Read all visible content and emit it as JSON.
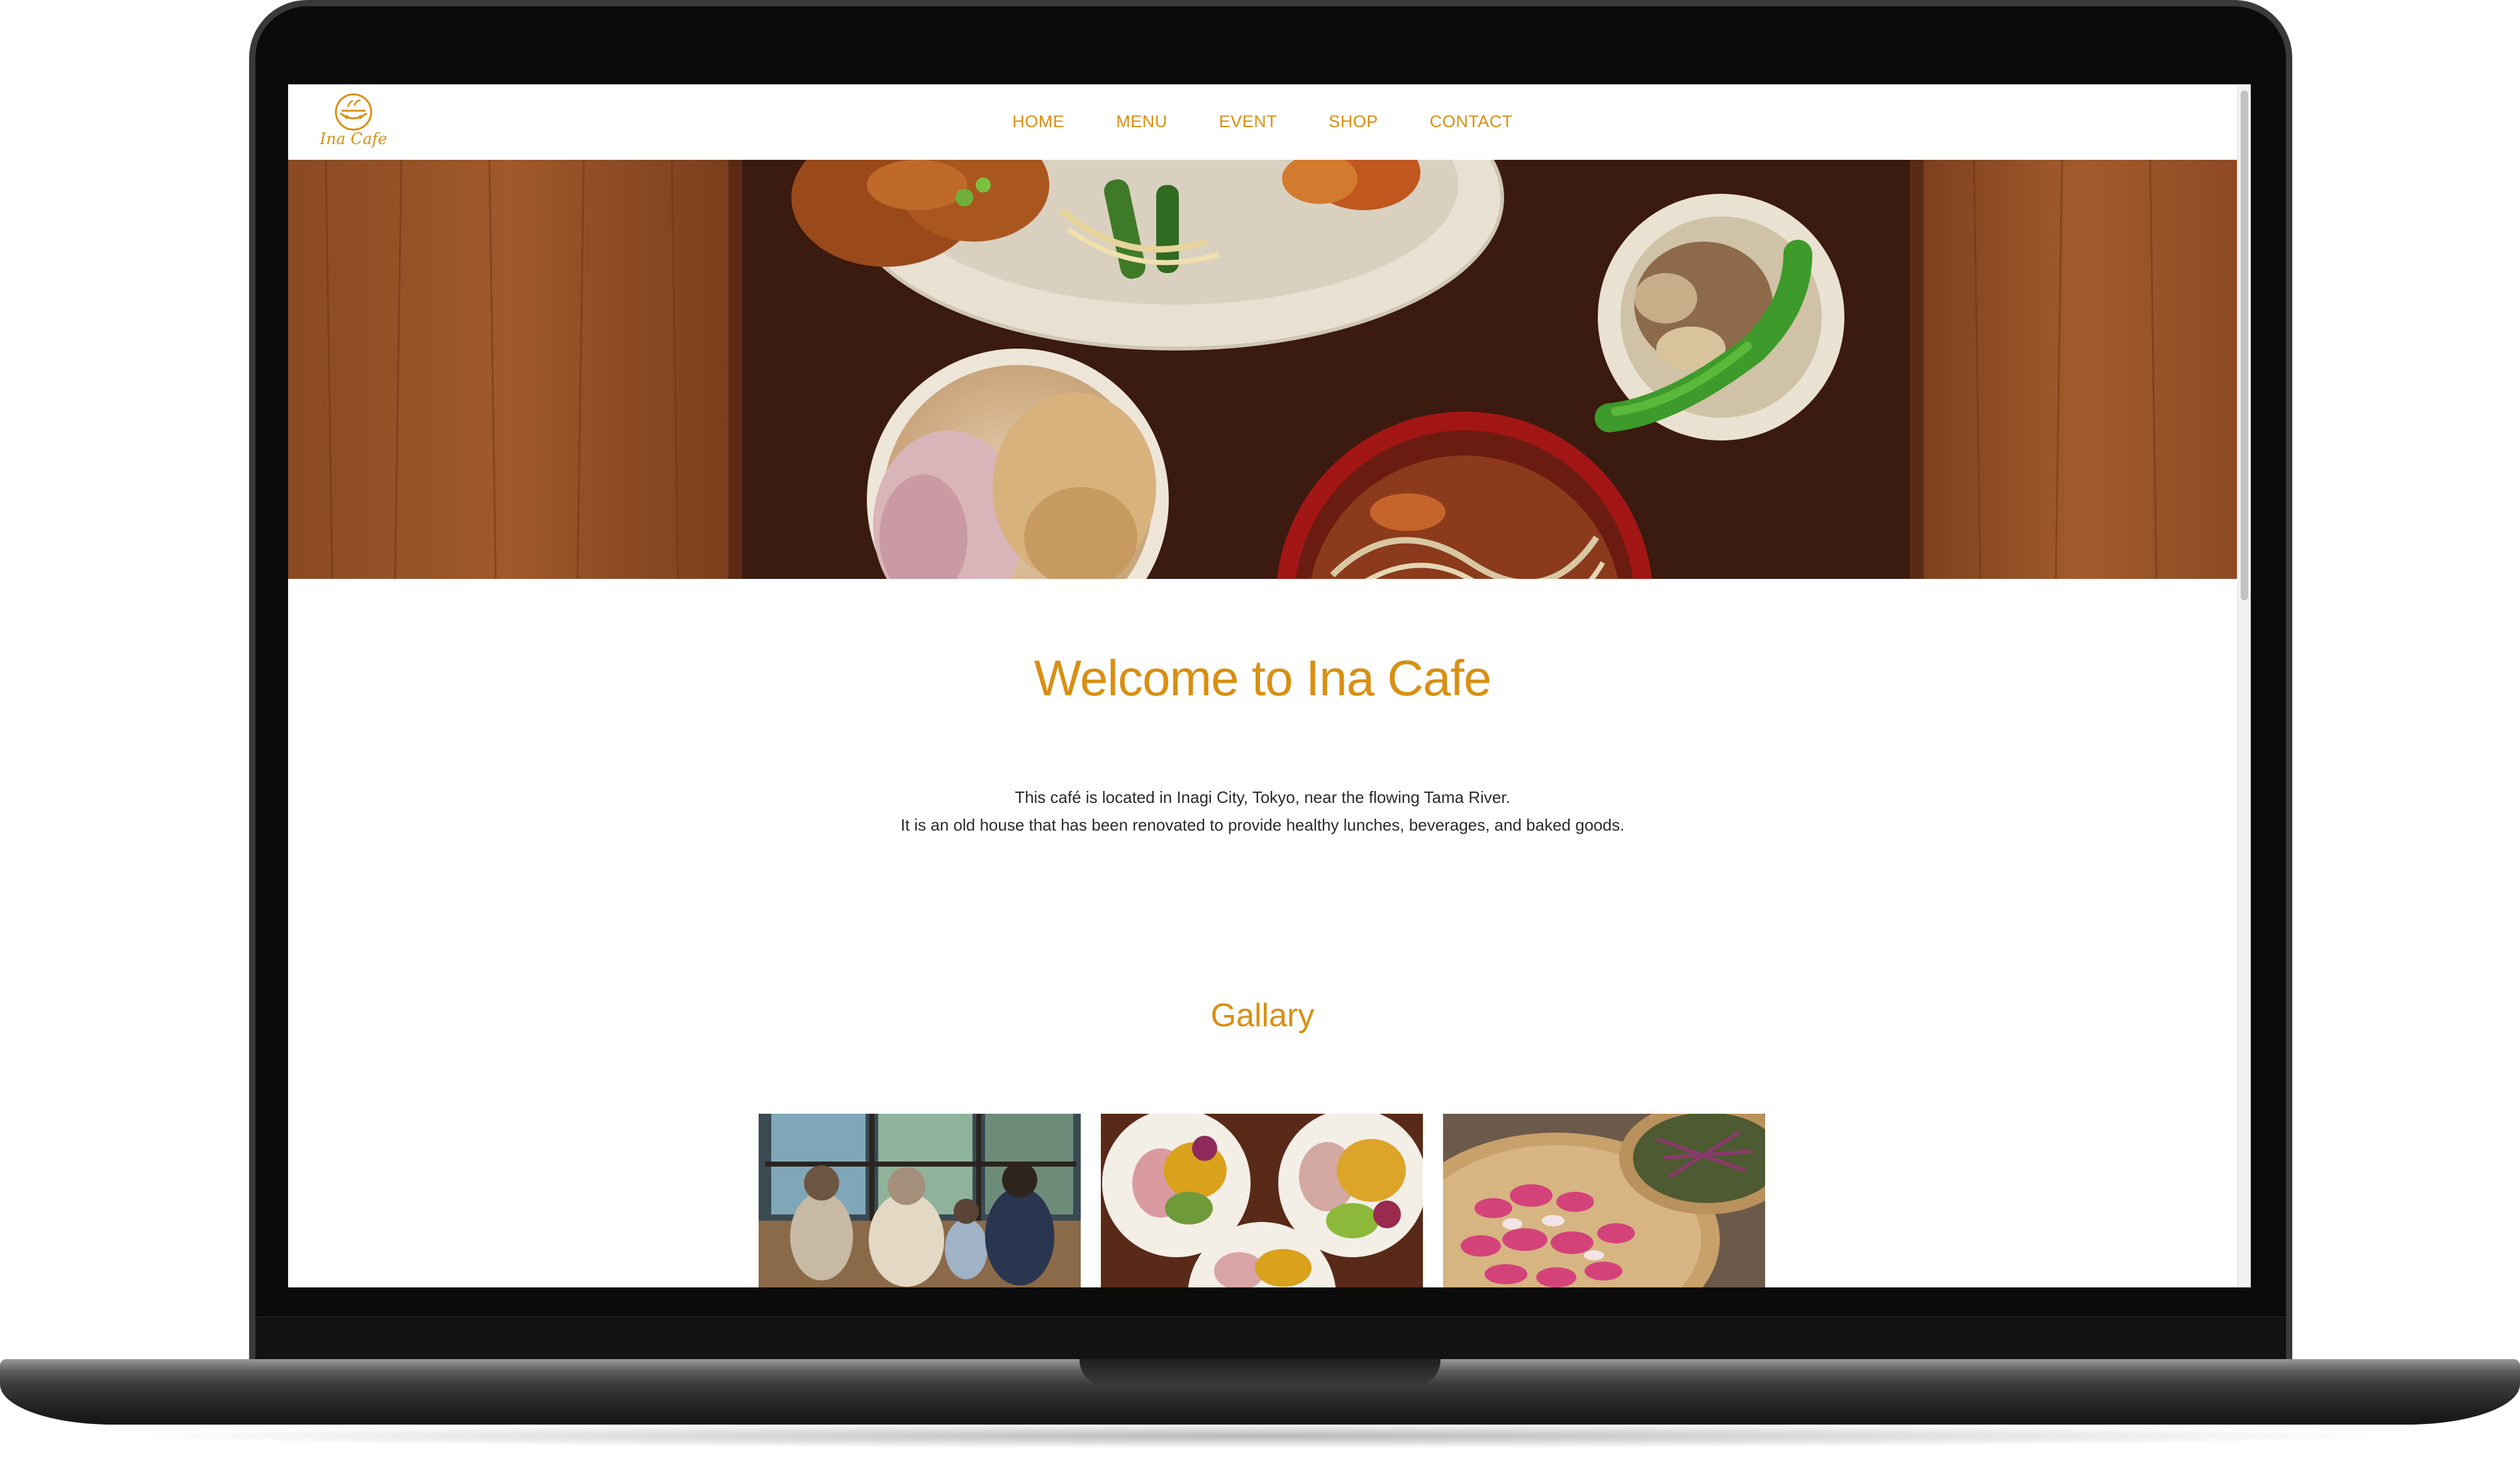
{
  "site": {
    "logo_text": "Ina Cafe",
    "brand_color": "#d98f12"
  },
  "nav": {
    "items": [
      {
        "label": "HOME"
      },
      {
        "label": "MENU"
      },
      {
        "label": "EVENT"
      },
      {
        "label": "SHOP"
      },
      {
        "label": "CONTACT"
      }
    ]
  },
  "hero": {
    "image": "food-tray-photo"
  },
  "main": {
    "title": "Welcome to Ina Cafe",
    "intro": [
      "This café is located in Inagi City, Tokyo, near the flowing Tama River.",
      "It is an old house that has been renovated to provide healthy lunches, beverages, and baked goods."
    ]
  },
  "gallery": {
    "title": "Gallary",
    "photos": [
      {
        "image": "family-at-window-photo"
      },
      {
        "image": "curry-plates-photo"
      },
      {
        "image": "pickled-vegetables-basket-photo"
      }
    ]
  }
}
